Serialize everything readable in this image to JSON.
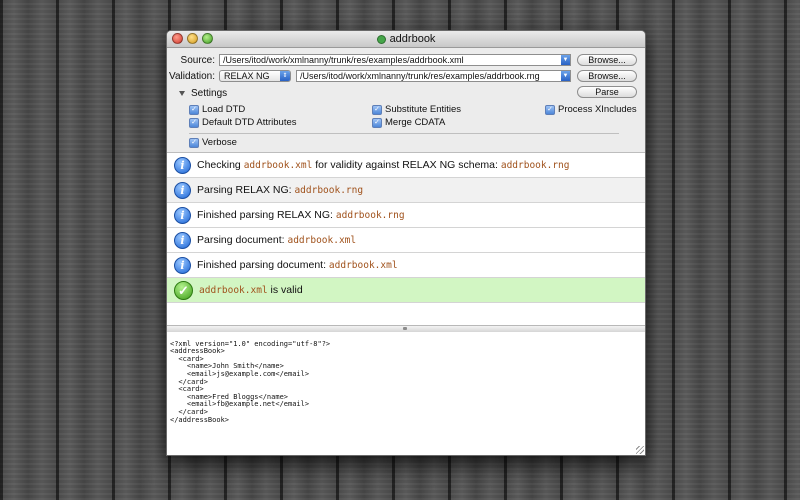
{
  "window": {
    "title": "addrbook"
  },
  "source": {
    "label": "Source:",
    "path": "/Users/itod/work/xmlnanny/trunk/res/examples/addrbook.xml",
    "browse_label": "Browse..."
  },
  "validation": {
    "label": "Validation:",
    "schema_type": "RELAX NG",
    "path": "/Users/itod/work/xmlnanny/trunk/res/examples/addrbook.rng",
    "browse_label": "Browse...",
    "parse_label": "Parse"
  },
  "settings": {
    "label": "Settings",
    "options": [
      {
        "label": "Load DTD",
        "checked": true
      },
      {
        "label": "Substitute Entities",
        "checked": true
      },
      {
        "label": "Process XIncludes",
        "checked": true
      },
      {
        "label": "Default DTD Attributes",
        "checked": true
      },
      {
        "label": "Merge CDATA",
        "checked": true
      },
      {
        "label": "Verbose",
        "checked": true
      }
    ]
  },
  "log": [
    {
      "type": "info",
      "text": "Checking ",
      "file": "addrbook.xml",
      "text2": " for validity against RELAX NG schema: ",
      "file2": "addrbook.rng"
    },
    {
      "type": "info",
      "text": "Parsing RELAX NG: ",
      "file": "addrbook.rng"
    },
    {
      "type": "info",
      "text": "Finished parsing RELAX NG: ",
      "file": "addrbook.rng"
    },
    {
      "type": "info",
      "text": "Parsing document: ",
      "file": "addrbook.xml"
    },
    {
      "type": "info",
      "text": "Finished parsing document: ",
      "file": "addrbook.xml"
    },
    {
      "type": "success",
      "file": "addrbook.xml",
      "text": " is valid"
    }
  ],
  "xml_source": [
    "<?xml version=\"1.0\" encoding=\"utf-8\"?>",
    "<addressBook>",
    "  <card>",
    "    <name>John Smith</name>",
    "    <email>js@example.com</email>",
    "  </card>",
    "  <card>",
    "    <name>Fred Bloggs</name>",
    "    <email>fb@example.net</email>",
    "  </card>",
    "</addressBook>"
  ]
}
